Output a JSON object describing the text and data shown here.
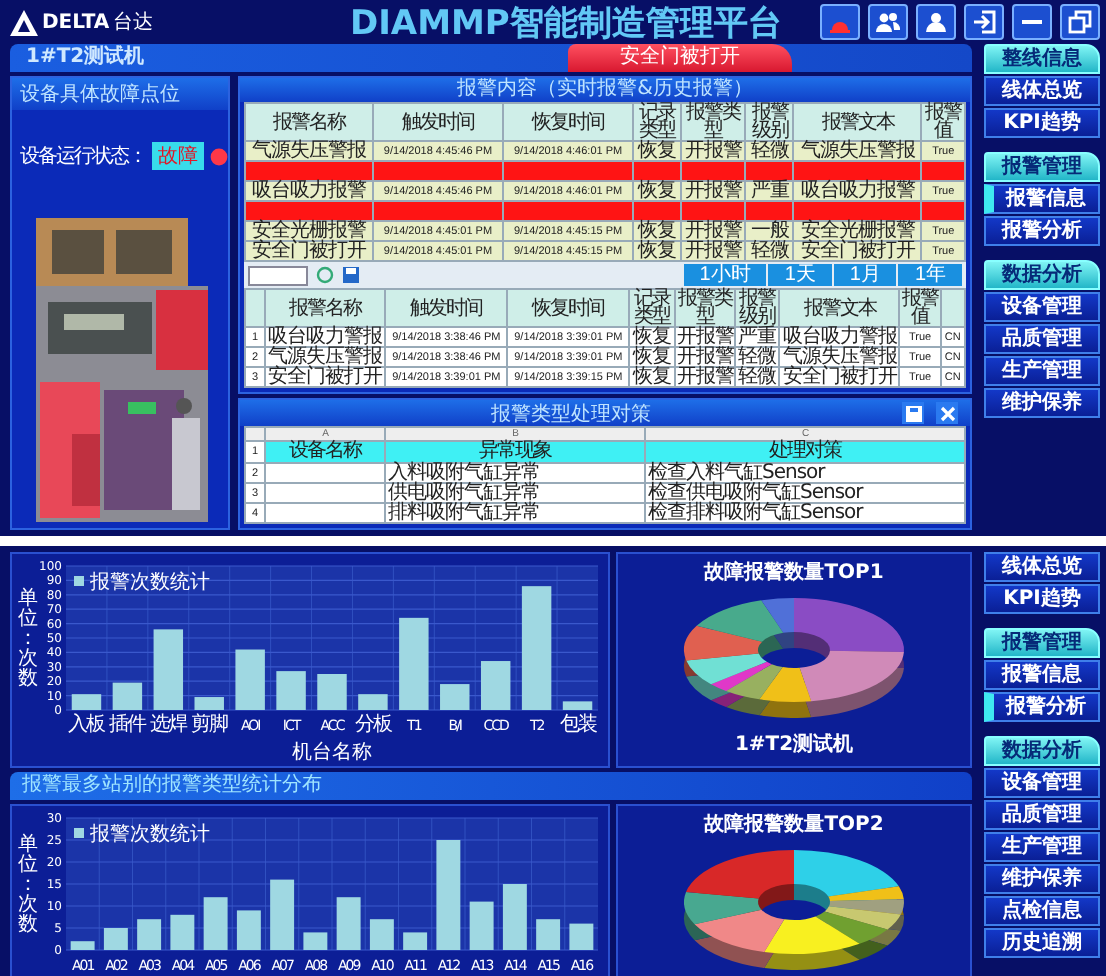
{
  "top_screen": {
    "header": {
      "logo": "DELTA",
      "logo_cn": "台达",
      "title": "DIAMMP智能制造管理平台"
    },
    "machine_bar": {
      "title": "1#T2测试机",
      "alert": "安全门被打开"
    },
    "fault_panel": {
      "title": "设备具体故障点位",
      "status_label": "设备运行状态：",
      "status": "故障"
    },
    "alarm_panel": {
      "title": "报警内容（实时报警&历史报警）",
      "realtime_table": {
        "columns": [
          "报警名称",
          "触发时间",
          "恢复时间",
          "记录类型",
          "报警类型",
          "报警级别",
          "报警文本",
          "报警值"
        ],
        "rows": [
          {
            "kind": "normal",
            "cells": [
              "气源失压警报",
              "9/14/2018 4:45:46 PM",
              "9/14/2018 4:46:01 PM",
              "恢复",
              "开报警",
              "轻微",
              "气源失压警报",
              "True"
            ]
          },
          {
            "kind": "active"
          },
          {
            "kind": "normal",
            "cells": [
              "吸台吸力报警",
              "9/14/2018 4:45:46 PM",
              "9/14/2018 4:46:01 PM",
              "恢复",
              "开报警",
              "严重",
              "吸台吸力报警",
              "True"
            ]
          },
          {
            "kind": "active"
          },
          {
            "kind": "normal",
            "cells": [
              "安全光栅报警",
              "9/14/2018 4:45:01 PM",
              "9/14/2018 4:45:15 PM",
              "恢复",
              "开报警",
              "一般",
              "安全光栅报警",
              "True"
            ]
          },
          {
            "kind": "normal",
            "cells": [
              "安全门被打开",
              "9/14/2018 4:45:01 PM",
              "9/14/2018 4:45:15 PM",
              "恢复",
              "开报警",
              "轻微",
              "安全门被打开",
              "True"
            ]
          }
        ]
      },
      "range_tabs": [
        {
          "label": "1小时",
          "selected": false
        },
        {
          "label": "1天",
          "selected": false
        },
        {
          "label": "1月",
          "selected": false
        },
        {
          "label": "1年",
          "selected": false
        }
      ],
      "history_table": {
        "columns": [
          "报警名称",
          "触发时间",
          "恢复时间",
          "记录类型",
          "报警类型",
          "报警级别",
          "报警文本",
          "报警值"
        ],
        "rows": [
          {
            "index": "1",
            "cells": [
              "吸台吸力警报",
              "9/14/2018 3:38:46 PM",
              "9/14/2018 3:39:01 PM",
              "恢复",
              "开报警",
              "严重",
              "吸台吸力警报",
              "True",
              "CN"
            ]
          },
          {
            "index": "2",
            "cells": [
              "气源失压警报",
              "9/14/2018 3:38:46 PM",
              "9/14/2018 3:39:01 PM",
              "恢复",
              "开报警",
              "轻微",
              "气源失压警报",
              "True",
              "CN"
            ]
          },
          {
            "index": "3",
            "cells": [
              "安全门被打开",
              "9/14/2018 3:39:01 PM",
              "9/14/2018 3:39:15 PM",
              "恢复",
              "开报警",
              "轻微",
              "安全门被打开",
              "True",
              "CN"
            ]
          }
        ]
      }
    },
    "strategy_panel": {
      "title": "报警类型处理对策",
      "sheet_columns": [
        "A",
        "B",
        "C"
      ],
      "header_index": "1",
      "headers": [
        "设备名称",
        "异常现象",
        "处理对策"
      ],
      "rows": [
        {
          "index": "2",
          "cells": [
            "入料吸附气缸异常",
            "检查入料气缸Sensor"
          ]
        },
        {
          "index": "3",
          "cells": [
            "供电吸附气缸异常",
            "检查供电吸附气缸Sensor"
          ]
        },
        {
          "index": "4",
          "cells": [
            "排料吸附气缸异常",
            "检查排料吸附气缸Sensor"
          ]
        }
      ]
    },
    "sidebar": [
      {
        "kind": "header",
        "label": "整线信息"
      },
      {
        "kind": "item",
        "label": "线体总览",
        "selected": false
      },
      {
        "kind": "item",
        "label": "KPI趋势",
        "selected": false
      },
      {
        "kind": "header",
        "label": "报警管理"
      },
      {
        "kind": "item",
        "label": "报警信息",
        "selected": true
      },
      {
        "kind": "item",
        "label": "报警分析",
        "selected": false
      },
      {
        "kind": "header",
        "label": "数据分析"
      },
      {
        "kind": "item",
        "label": "设备管理",
        "selected": false
      },
      {
        "kind": "item",
        "label": "品质管理",
        "selected": false
      },
      {
        "kind": "item",
        "label": "生产管理",
        "selected": false
      },
      {
        "kind": "item",
        "label": "维护保养",
        "selected": false
      }
    ]
  },
  "bottom_screen": {
    "machine_chart": {
      "chart_data": {
        "type": "bar",
        "xlabel": "机台名称",
        "ylabel": "单位：次数",
        "categories": [
          "入板",
          "插件",
          "选焊",
          "剪脚",
          "AOI",
          "ICT",
          "ACC",
          "分板",
          "T1",
          "B/I",
          "CCD",
          "T2",
          "包装"
        ],
        "series": [
          {
            "name": "报警次数统计",
            "color": "#9fd8e2",
            "values": [
              11,
              19,
              56,
              9,
              42,
              27,
              25,
              11,
              64,
              18,
              34,
              86,
              6
            ]
          }
        ],
        "ylim": [
          0,
          100
        ],
        "grid": true,
        "yticks": [
          0,
          10,
          20,
          30,
          40,
          50,
          60,
          70,
          80,
          90,
          100
        ]
      }
    },
    "donut_top1": {
      "title": "故障报警数量TOP1",
      "caption": "1#T2测试机"
    },
    "station_panel": {
      "title": "报警最多站别的报警类型统计分布",
      "chart_data": {
        "type": "bar",
        "ylabel": "单位：次数",
        "categories": [
          "A01",
          "A02",
          "A03",
          "A04",
          "A05",
          "A06",
          "A07",
          "A08",
          "A09",
          "A10",
          "A11",
          "A12",
          "A13",
          "A14",
          "A15",
          "A16"
        ],
        "series": [
          {
            "name": "报警次数统计",
            "color": "#9fd8e2",
            "values": [
              2,
              5,
              7,
              8,
              12,
              9,
              16,
              4,
              12,
              7,
              4,
              25,
              11,
              15,
              7,
              6
            ]
          }
        ],
        "ylim": [
          0,
          30
        ],
        "grid": true,
        "yticks": [
          0,
          5,
          10,
          15,
          20,
          25,
          30
        ]
      }
    },
    "donut_top2": {
      "title": "故障报警数量TOP2"
    },
    "sidebar": [
      {
        "kind": "item",
        "label": "线体总览",
        "selected": false
      },
      {
        "kind": "item",
        "label": "KPI趋势",
        "selected": false
      },
      {
        "kind": "header",
        "label": "报警管理"
      },
      {
        "kind": "item",
        "label": "报警信息",
        "selected": false
      },
      {
        "kind": "item",
        "label": "报警分析",
        "selected": true
      },
      {
        "kind": "header",
        "label": "数据分析"
      },
      {
        "kind": "item",
        "label": "设备管理",
        "selected": false
      },
      {
        "kind": "item",
        "label": "品质管理",
        "selected": false
      },
      {
        "kind": "item",
        "label": "生产管理",
        "selected": false
      },
      {
        "kind": "item",
        "label": "维护保养",
        "selected": false
      },
      {
        "kind": "item",
        "label": "点检信息",
        "selected": false
      },
      {
        "kind": "item",
        "label": "历史追溯",
        "selected": false
      }
    ]
  }
}
